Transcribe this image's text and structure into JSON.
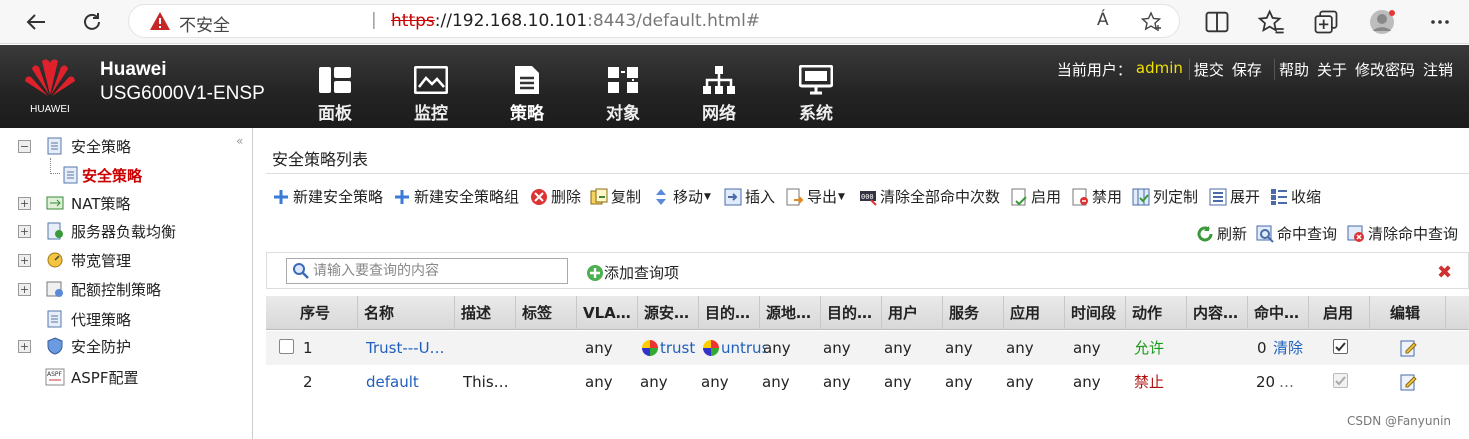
{
  "browser": {
    "insecure_label": "不安全",
    "separator": "|",
    "url_protocol": "https",
    "url_host": "://192.168.10.101",
    "url_rest": ":8443/default.html#",
    "reader_label": "Á"
  },
  "header": {
    "brand_logo_text": "HUAWEI",
    "brand_name": "Huawei",
    "model": "USG6000V1-ENSP",
    "nav": [
      {
        "label": "面板",
        "icon": "dashboard-icon"
      },
      {
        "label": "监控",
        "icon": "monitor-icon"
      },
      {
        "label": "策略",
        "icon": "policy-icon"
      },
      {
        "label": "对象",
        "icon": "object-icon"
      },
      {
        "label": "网络",
        "icon": "network-icon"
      },
      {
        "label": "系统",
        "icon": "system-icon"
      }
    ],
    "user_label": "当前用户：",
    "user": "admin",
    "actions": [
      "提交",
      "保存",
      "帮助",
      "关于",
      "修改密码",
      "注销"
    ]
  },
  "sidebar": {
    "items": [
      {
        "label": "安全策略",
        "expand": "−"
      },
      {
        "label": "安全策略",
        "active": true
      },
      {
        "label": "NAT策略",
        "expand": "+"
      },
      {
        "label": "服务器负载均衡",
        "expand": "+"
      },
      {
        "label": "带宽管理",
        "expand": "+"
      },
      {
        "label": "配额控制策略",
        "expand": "+"
      },
      {
        "label": "代理策略"
      },
      {
        "label": "安全防护",
        "expand": "+"
      },
      {
        "label": "ASPF配置"
      }
    ]
  },
  "main": {
    "title": "安全策略列表",
    "toolbar": [
      "新建安全策略",
      "新建安全策略组",
      "删除",
      "复制",
      "移动",
      "插入",
      "导出",
      "清除全部命中次数",
      "启用",
      "禁用",
      "列定制",
      "展开",
      "收缩"
    ],
    "toolbar2": [
      "刷新",
      "命中查询",
      "清除命中查询"
    ],
    "search_placeholder": "请输入要查询的内容",
    "add_query": "添加查询项",
    "columns": [
      "序号",
      "名称",
      "描述",
      "标签",
      "VLA…",
      "源安…",
      "目的…",
      "源地…",
      "目的…",
      "用户",
      "服务",
      "应用",
      "时间段",
      "动作",
      "内容…",
      "命中…",
      "启用",
      "编辑"
    ],
    "rows": [
      {
        "no": "1",
        "name": "Trust---U…",
        "desc": "",
        "tag": "",
        "vlan": "any",
        "src_zone": "trust",
        "dst_zone": "untrust",
        "src_addr": "any",
        "dst_addr": "any",
        "user": "any",
        "service": "any",
        "app": "any",
        "time": "any",
        "action": "允许",
        "content": "",
        "hits": "0",
        "clear": "清除",
        "enabled": true
      },
      {
        "no": "2",
        "name": "default",
        "desc": "This…",
        "tag": "",
        "vlan": "any",
        "src_zone": "any",
        "dst_zone": "any",
        "src_addr": "any",
        "dst_addr": "any",
        "user": "any",
        "service": "any",
        "app": "any",
        "time": "any",
        "action": "禁止",
        "content": "",
        "hits": "20",
        "clear": "…",
        "enabled": true
      }
    ]
  },
  "watermark": "CSDN @Fanyunin"
}
